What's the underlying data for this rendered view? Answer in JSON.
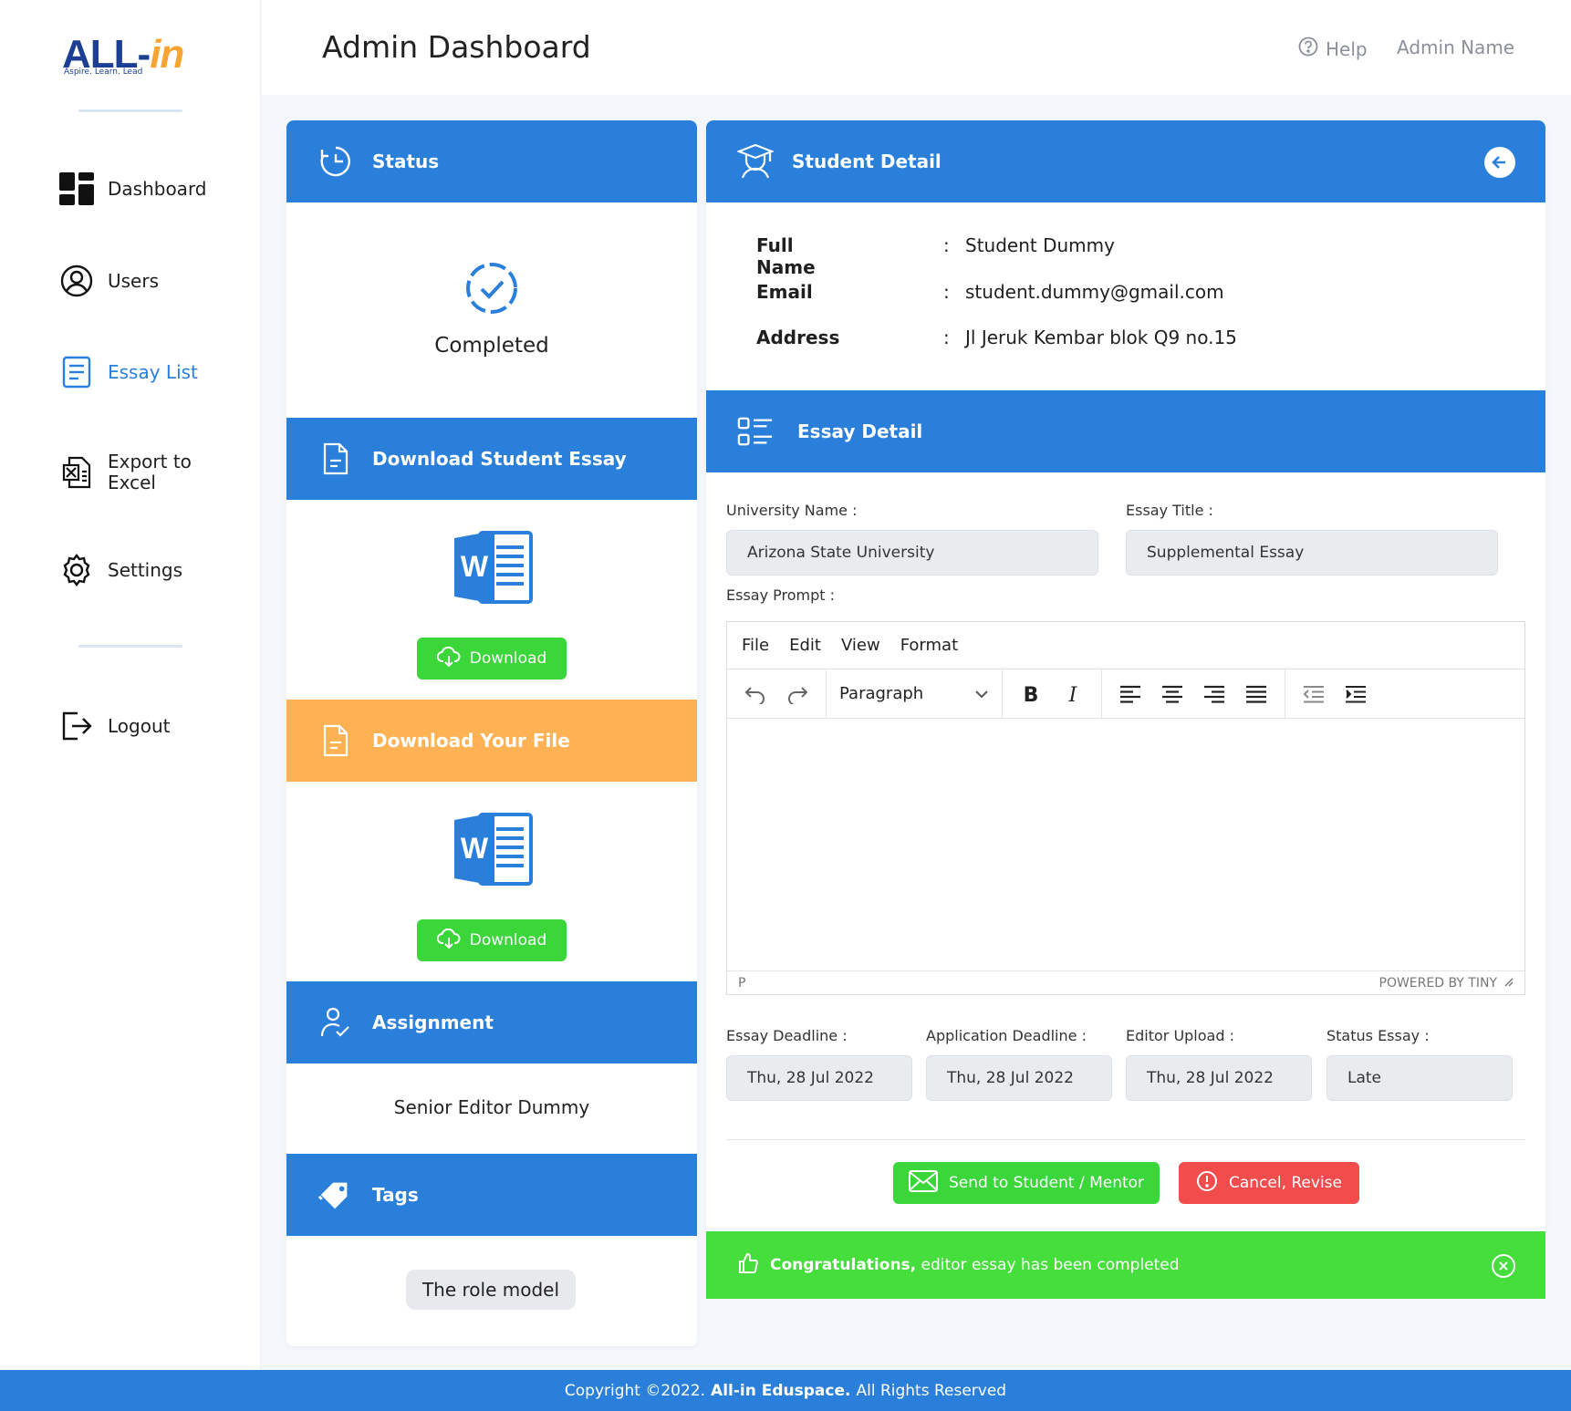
{
  "brand": {
    "logo_text_main": "ALL-",
    "logo_text_accent": "in",
    "tagline": "Aspire. Learn. Lead"
  },
  "sidebar": {
    "items": [
      {
        "label": "Dashboard",
        "icon": "dashboard-grid-icon"
      },
      {
        "label": "Users",
        "icon": "user-circle-icon"
      },
      {
        "label": "Essay List",
        "icon": "document-list-icon"
      },
      {
        "label": "Export to\nExcel",
        "icon": "excel-icon"
      },
      {
        "label": "Settings",
        "icon": "gear-icon"
      },
      {
        "label": "Logout",
        "icon": "logout-icon"
      }
    ],
    "active_color": "#2a7fdb"
  },
  "header": {
    "title": "Admin Dashboard",
    "help_label": "Help",
    "user_name": "Admin Name"
  },
  "status_card": {
    "title": "Status",
    "status_text": "Completed"
  },
  "download_student_card": {
    "title": "Download Student Essay",
    "button_label": "Download"
  },
  "download_your_card": {
    "title": "Download Your File",
    "button_label": "Download"
  },
  "assignment_card": {
    "title": "Assignment",
    "assignee": "Senior Editor Dummy"
  },
  "tags_card": {
    "title": "Tags",
    "tags": [
      "The role model"
    ]
  },
  "student_detail": {
    "title": "Student Detail",
    "rows": [
      {
        "label": "Full Name",
        "value": "Student Dummy"
      },
      {
        "label": "Email",
        "value": "student.dummy@gmail.com"
      },
      {
        "label": "Address",
        "value": "Jl Jeruk Kembar blok Q9 no.15"
      }
    ],
    "colon": ":"
  },
  "essay_detail": {
    "title": "Essay Detail",
    "university_label": "University Name :",
    "university_value": "Arizona State University",
    "essay_title_label": "Essay Title :",
    "essay_title_value": "Supplemental Essay",
    "prompt_label": "Essay Prompt :",
    "editor": {
      "menu": [
        "File",
        "Edit",
        "View",
        "Format"
      ],
      "block_format": "Paragraph",
      "status_path": "P",
      "powered_by": "POWERED BY TINY"
    },
    "essay_deadline_label": "Essay Deadline :",
    "essay_deadline_value": "Thu, 28 Jul 2022",
    "application_deadline_label": "Application Deadline :",
    "application_deadline_value": "Thu, 28 Jul 2022",
    "editor_upload_label": "Editor Upload :",
    "editor_upload_value": "Thu, 28 Jul 2022",
    "status_essay_label": "Status Essay :",
    "status_essay_value": "Late",
    "send_button": "Send to Student / Mentor",
    "cancel_button": "Cancel, Revise"
  },
  "alert": {
    "strong": "Congratulations,",
    "message": " editor essay has been completed"
  },
  "footer": {
    "prefix": "Copyright ©2022.",
    "company": "All-in Eduspace.",
    "suffix": "All Rights Reserved"
  },
  "colors": {
    "primary": "#2a7fdb",
    "orange": "#ffb254",
    "green": "#3ad63a",
    "red": "#f24c4c",
    "alert_green": "#46de3c"
  }
}
